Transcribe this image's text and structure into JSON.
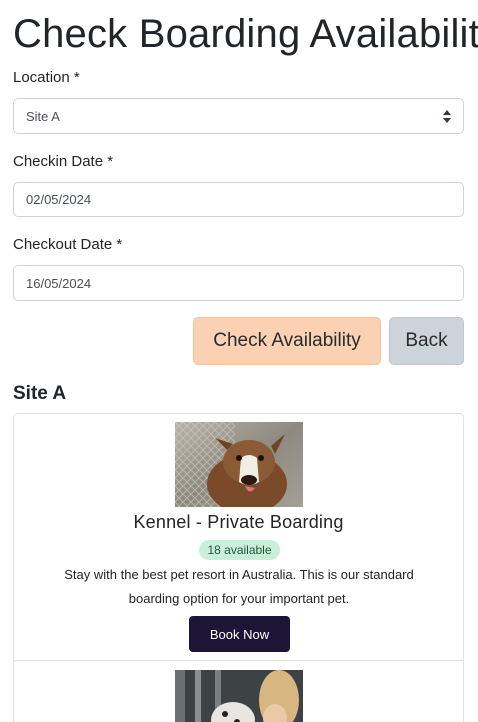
{
  "page": {
    "title": "Check Boarding Availability"
  },
  "form": {
    "location": {
      "label": "Location *",
      "value": "Site A"
    },
    "checkin": {
      "label": "Checkin Date *",
      "value": "02/05/2024"
    },
    "checkout": {
      "label": "Checkout Date *",
      "value": "16/05/2024"
    },
    "check_button": "Check Availability",
    "back_button": "Back"
  },
  "results": {
    "site_name": "Site A",
    "items": [
      {
        "title": "Kennel - Private Boarding",
        "availability": "18 available",
        "description": "Stay with the best pet resort in Australia. This is our standard boarding option for your important pet.",
        "book_button": "Book Now"
      }
    ]
  },
  "colors": {
    "check_button_bg": "#fad2b3",
    "back_button_bg": "#cdd3da",
    "book_button_bg": "#1c1535",
    "badge_bg": "#c8f0d8"
  }
}
